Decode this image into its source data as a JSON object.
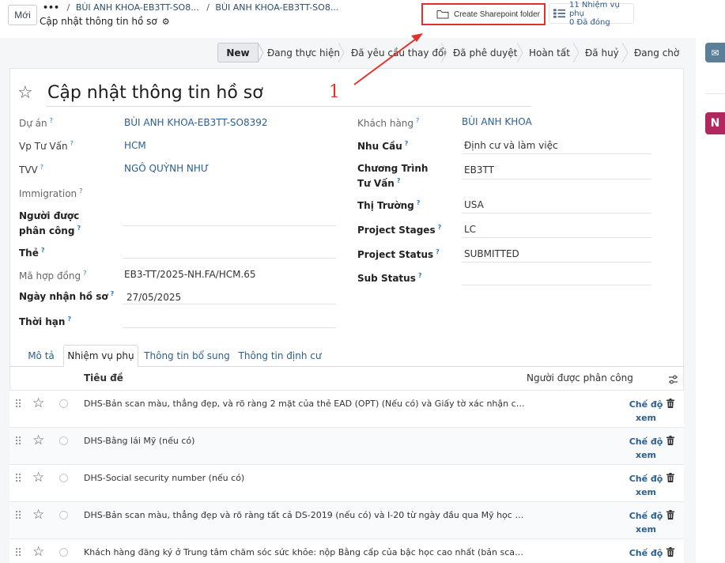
{
  "topbar": {
    "new_label": "Mới",
    "breadcrumb_more": "•••",
    "breadcrumbs": [
      "BÙI ANH KHOA-EB3TT-SO8...",
      "BÙI ANH KHOA-EB3TT-SO8..."
    ],
    "page_subtitle": "Cập nhật thông tin hồ sơ",
    "sharepoint_label": "Create Sharepoint folder",
    "subtasks_line1": "11 Nhiệm vụ phụ",
    "subtasks_line2": "0 Đã đóng"
  },
  "status_stages": [
    "New",
    "Đang thực hiện",
    "Đã yêu cầu thay đổi",
    "Đã phê duyệt",
    "Hoàn tất",
    "Đã huỷ",
    "Đang chờ"
  ],
  "active_stage": "New",
  "side_tabs": {
    "mail": "✉",
    "note": "N"
  },
  "annotation": {
    "label": "1",
    "color": "#e0322b"
  },
  "record": {
    "title": "Cập nhật thông tin hồ sơ",
    "left_fields": [
      {
        "label": "Dự án",
        "value": "BÙI ANH KHOA-EB3TT-SO8392"
      },
      {
        "label": "Vp Tư Vấn",
        "value": "HCM"
      },
      {
        "label": "TVV",
        "value": "NGÔ QUỲNH NHƯ"
      },
      {
        "label": "Immigration",
        "value": ""
      },
      {
        "label": "Người được phân công",
        "value": ""
      },
      {
        "label": "Thẻ",
        "value": ""
      },
      {
        "label": "Mã hợp đồng",
        "value": "EB3-TT/2025-NH.FA/HCM.65"
      },
      {
        "label": "Ngày nhận hồ sơ",
        "value": "27/05/2025"
      },
      {
        "label": "Thời hạn",
        "value": ""
      }
    ],
    "right_fields": [
      {
        "label": "Khách hàng",
        "value": "BÙI ANH KHOA"
      },
      {
        "label": "Nhu Cầu",
        "value": "Định cư và làm việc"
      },
      {
        "label": "Chương Trình Tư Vấn",
        "value": "EB3TT"
      },
      {
        "label": "Thị Trường",
        "value": "USA"
      },
      {
        "label": "Project Stages",
        "value": "LC"
      },
      {
        "label": "Project Status",
        "value": "SUBMITTED"
      },
      {
        "label": "Sub Status",
        "value": ""
      }
    ],
    "help_mark": "?"
  },
  "tabs": [
    "Mô tả",
    "Nhiệm vụ phụ",
    "Thông tin bổ sung",
    "Thông tin định cư"
  ],
  "active_tab": "Nhiệm vụ phụ",
  "subtask_table": {
    "headers": {
      "title": "Tiêu đề",
      "assignee": "Người được phân công"
    },
    "view_label_1": "Chế độ",
    "view_label_2": "xem",
    "rows": [
      "DHS-Bản scan màu, thẳng đẹp, và rõ ràng 2 mặt của thẻ EAD (OPT) (Nếu có) và Giấy tờ xác nhận công việc ...",
      "DHS-Bằng lái Mỹ (nếu có)",
      "DHS-Social security number (nếu có)",
      "DHS-Bản scan màu, thẳng đẹp và rõ ràng tất cả DS-2019 (nếu có) và I-20 từ ngày đầu qua Mỹ học đến t...",
      "Khách hàng đăng ký ở Trung tâm chăm sóc sức khỏe: nộp Bằng cấp của bậc học cao nhất (bản scan thẳn..."
    ]
  }
}
